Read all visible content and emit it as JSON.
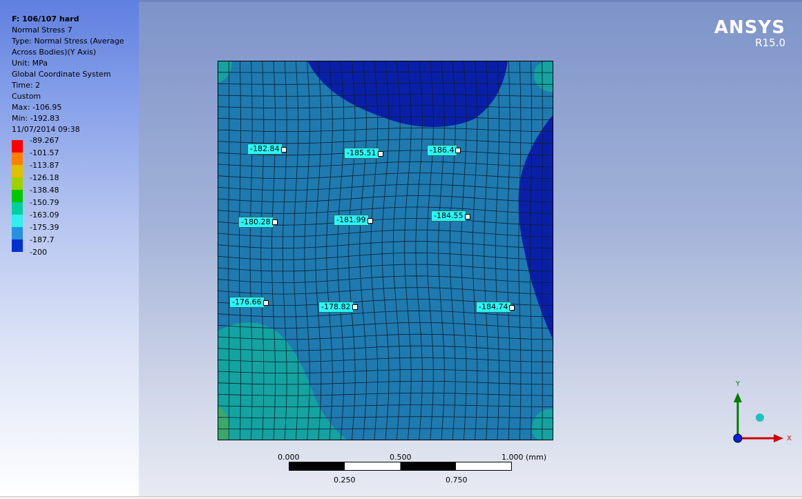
{
  "info": {
    "title": "F: 106/107 hard",
    "lines": [
      "Normal Stress 7",
      "Type: Normal Stress (Average Across Bodies)(Y Axis)",
      "Unit: MPa",
      "Global Coordinate System",
      "Time: 2",
      "Custom",
      "Max: -106.95",
      "Min: -192.83",
      "11/07/2014 09:38"
    ]
  },
  "legend": {
    "labels": [
      "-89.267",
      "-101.57",
      "-113.87",
      "-126.18",
      "-138.48",
      "-150.79",
      "-163.09",
      "-175.39",
      "-187.7",
      "-200"
    ],
    "colors": [
      "#ff0000",
      "#ff8000",
      "#e0c000",
      "#a0d000",
      "#00c800",
      "#00d0a0",
      "#30f0f0",
      "#2890e0",
      "#0030d0"
    ]
  },
  "logo": {
    "brand": "ANSYS",
    "version": "R15.0"
  },
  "contour_colors": {
    "main": "#1f7ab0",
    "cool": "#0a1fa8",
    "warm": "#14a3a0",
    "hot": "#3aa86a",
    "mesh_line": "#0a1e30"
  },
  "probes": [
    {
      "value": "-182.84"
    },
    {
      "value": "-185.51"
    },
    {
      "value": "-186.4"
    },
    {
      "value": "-180.28"
    },
    {
      "value": "-181.99"
    },
    {
      "value": "-184.55"
    },
    {
      "value": "-176.66"
    },
    {
      "value": "-178.82"
    },
    {
      "value": "-184.74"
    }
  ],
  "scale": {
    "top_labels": [
      "0.000",
      "0.500",
      "1.000 (mm)"
    ],
    "bottom_labels": [
      "0.250",
      "0.750"
    ]
  },
  "triad": {
    "y_label": "Y",
    "x_label": "X"
  }
}
